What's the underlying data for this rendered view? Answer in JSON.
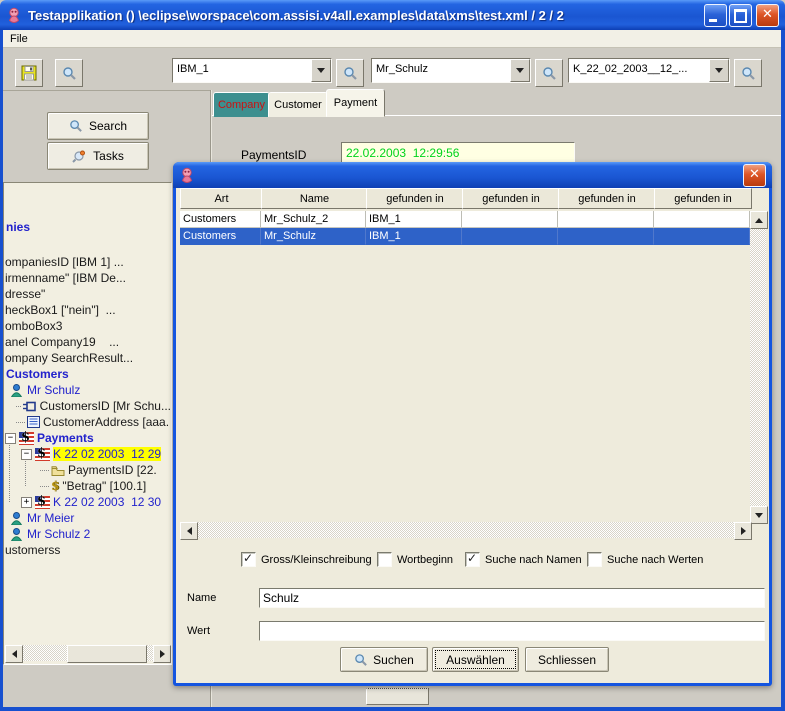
{
  "window": {
    "title": "Testapplikation () \\eclipse\\worspace\\com.assisi.v4all.examples\\data\\xms\\test.xml / 2 / 2"
  },
  "menubar": {
    "items": [
      {
        "label": "File"
      }
    ]
  },
  "toolbar": {
    "combos": [
      {
        "name": "company",
        "value": "IBM_1"
      },
      {
        "name": "customer",
        "value": "Mr_Schulz"
      },
      {
        "name": "payment",
        "value": "K_22_02_2003__12_..."
      }
    ]
  },
  "left_panel": {
    "search_button": "Search",
    "tasks_button": "Tasks"
  },
  "tree": {
    "items": [
      {
        "text": "nies",
        "style": "bold-blue"
      },
      {
        "text": "ompaniesID [IBM 1] ...",
        "style": "black"
      },
      {
        "text": "irmenname\" [IBM De...",
        "style": "black"
      },
      {
        "text": "dresse\"",
        "style": "black"
      },
      {
        "text": "heckBox1 [\"nein\"]  ...",
        "style": "black"
      },
      {
        "text": "omboBox3",
        "style": "black"
      },
      {
        "text": "anel Company19    ...",
        "style": "black"
      },
      {
        "text": "ompany SearchResult...",
        "style": "black"
      },
      {
        "text": "Customers",
        "style": "bold-blue"
      },
      {
        "text": "Mr Schulz",
        "style": "blue",
        "icon": "person"
      },
      {
        "text": "CustomersID [Mr Schu...",
        "style": "black",
        "icon": "plug"
      },
      {
        "text": "CustomerAddress [aaa.",
        "style": "black",
        "icon": "form"
      },
      {
        "text": "Payments",
        "style": "bold-blue",
        "icon": "dollar-flag",
        "expander": "−",
        "expanded": true
      },
      {
        "text": "K 22 02 2003  12 29",
        "style": "blue",
        "icon": "dollar-flag",
        "expander": "−",
        "expanded": true,
        "selected": true
      },
      {
        "text": "PaymentsID [22.",
        "style": "black",
        "icon": "folder"
      },
      {
        "text": "\"Betrag\" [100.1]",
        "style": "black",
        "icon": "dollar"
      },
      {
        "text": "K 22 02 2003  12 30",
        "style": "blue",
        "icon": "dollar-flag",
        "expander": "+",
        "expanded": false
      },
      {
        "text": "Mr Meier",
        "style": "blue",
        "icon": "person"
      },
      {
        "text": "Mr Schulz 2",
        "style": "blue",
        "icon": "person"
      },
      {
        "text": "ustomerss",
        "style": "black"
      }
    ]
  },
  "main": {
    "tabs": [
      {
        "label": "Company",
        "fg": "#cc1111",
        "bg": "#3d8f8f",
        "active": false
      },
      {
        "label": "Customer",
        "fg": "#000000",
        "bg": "#f0eee2",
        "active": false
      },
      {
        "label": "Payment",
        "fg": "#000000",
        "bg": "#f6f4ea",
        "active": true
      }
    ],
    "payments_id_label": "PaymentsID",
    "payments_id_value": "22.02.2003  12:29:56"
  },
  "dialog": {
    "table": {
      "headers": [
        "Art",
        "Name",
        "gefunden in",
        "gefunden in",
        "gefunden in",
        "gefunden in"
      ],
      "rows": [
        {
          "selected": false,
          "cells": [
            "Customers",
            "Mr_Schulz_2",
            "IBM_1",
            "",
            "",
            ""
          ]
        },
        {
          "selected": true,
          "cells": [
            "Customers",
            "Mr_Schulz",
            "IBM_1",
            "",
            "",
            ""
          ]
        }
      ]
    },
    "checkboxes": [
      {
        "label": "Gross/Kleinschreibung",
        "checked": true
      },
      {
        "label": "Wortbeginn",
        "checked": false
      },
      {
        "label": "Suche nach Namen",
        "checked": true
      },
      {
        "label": "Suche nach Werten",
        "checked": false
      }
    ],
    "fields": [
      {
        "label": "Name",
        "value": "Schulz"
      },
      {
        "label": "Wert",
        "value": ""
      }
    ],
    "buttons": [
      {
        "label": "Suchen",
        "icon": "magnifier"
      },
      {
        "label": "Auswählen",
        "focused": true
      },
      {
        "label": "Schliessen"
      }
    ]
  },
  "colors": {
    "titlebar_blue": "#1a56d2",
    "window_border_blue": "#1750cf",
    "selection_blue": "#2e62c8",
    "tree_selection_yellow": "#ffff00",
    "company_tab_bg": "#3d8f8f",
    "company_tab_fg": "#cc1111",
    "value_green": "#00d41c",
    "dialog_beige": "#eeebdc",
    "tree_bg": "#f2efe1"
  }
}
